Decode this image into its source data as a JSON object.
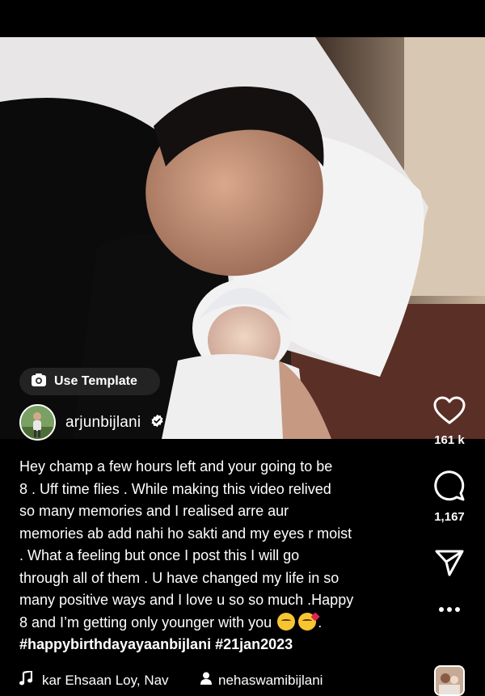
{
  "post": {
    "use_template_label": "Use Template",
    "username": "arjunbijlani",
    "caption_lines": [
      "Hey champ a few hours left and your going to be",
      "8 . Uff time flies . While making this video relived",
      "so many memories and I realised arre aur",
      "memories ab add nahi ho sakti and my eyes r moist",
      ". What a feeling but once I post this I will go",
      "through all of them . U have changed my life in so",
      "many positive ways and I love u so so much .Happy",
      "8 and I’m getting only younger with you"
    ],
    "caption_end": ".",
    "hashtags": "#happybirthdayayaanbijlani #21jan2023",
    "music_text": "kar Ehsaan Loy, Nav",
    "tagged_user": "nehaswamibijlani"
  },
  "actions": {
    "likes": "161 k",
    "comments": "1,167"
  },
  "icons": [
    "camera-icon",
    "verified-badge-icon",
    "heart-icon",
    "comment-icon",
    "share-icon",
    "more-icon",
    "music-note-icon",
    "person-icon"
  ]
}
